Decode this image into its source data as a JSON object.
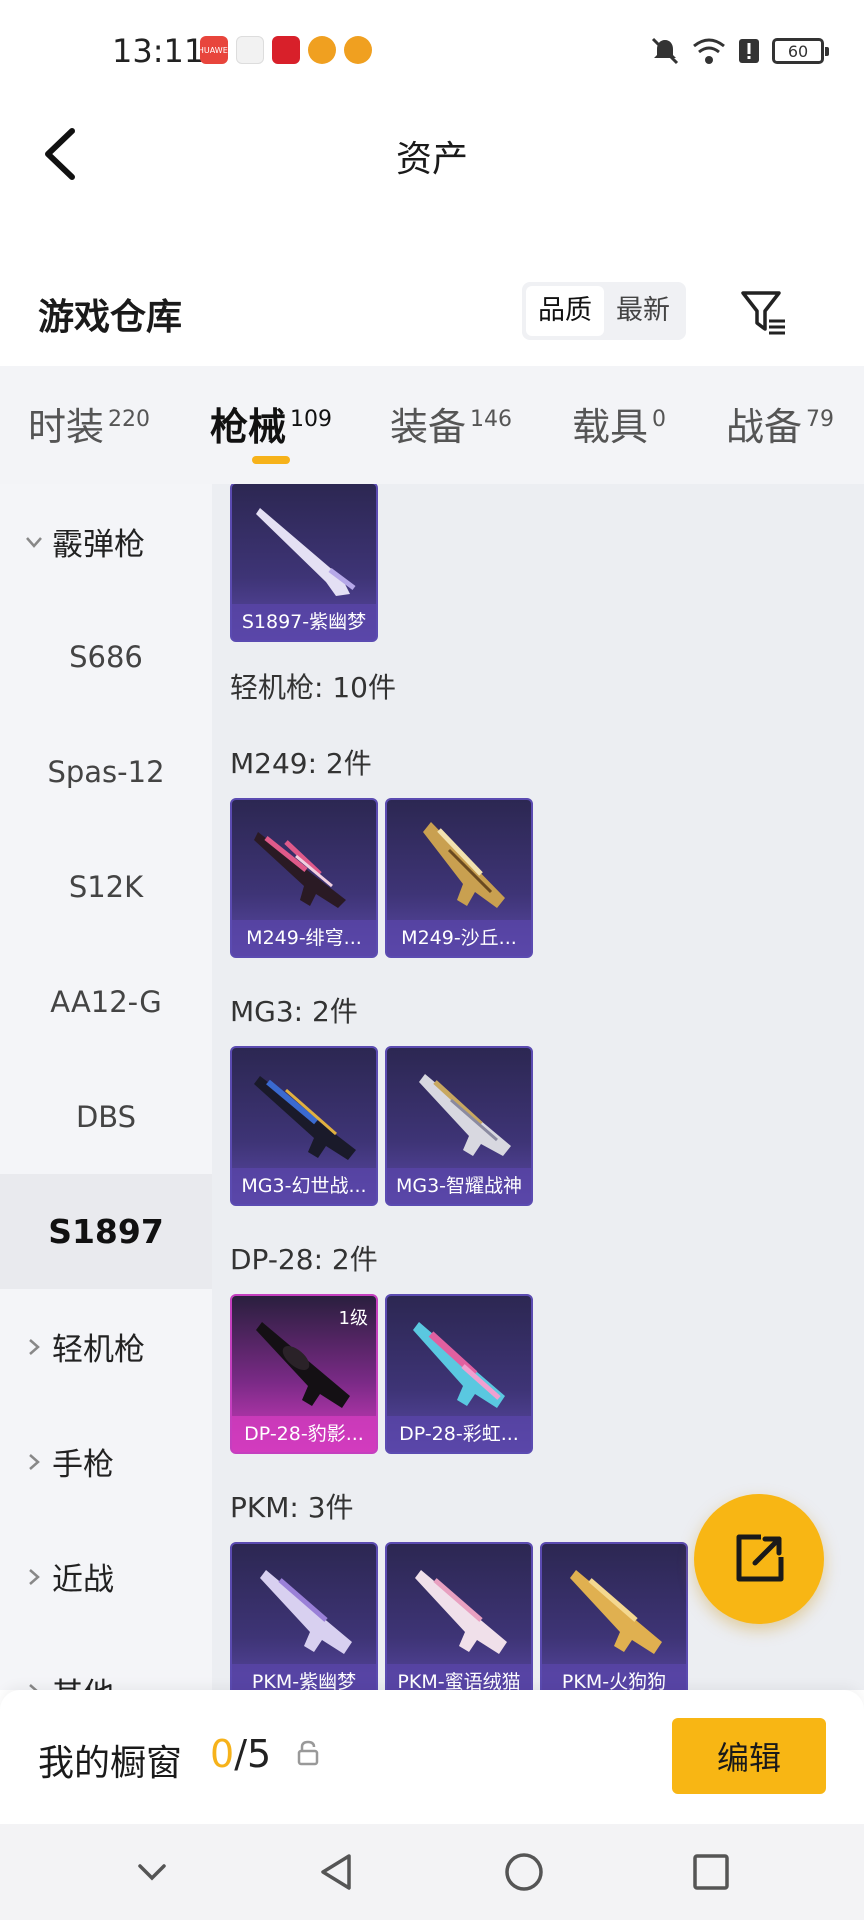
{
  "status_bar": {
    "time": "13:11",
    "battery": "60",
    "apps": [
      {
        "name": "huawei-app-icon",
        "color": "#e8453c",
        "label": "HUAWEI"
      },
      {
        "name": "gift-app-icon",
        "color": "#e05a6a",
        "label": ""
      },
      {
        "name": "heart-app-icon",
        "color": "#d8202a",
        "label": ""
      },
      {
        "name": "cat-app-icon",
        "color": "#f0a020",
        "label": ""
      },
      {
        "name": "cat-app-icon-2",
        "color": "#f0a020",
        "label": ""
      }
    ]
  },
  "header": {
    "title": "资产"
  },
  "section": {
    "title": "游戏仓库",
    "sort_quality": "品质",
    "sort_newest": "最新"
  },
  "tabs": [
    {
      "label": "时装",
      "count": "220"
    },
    {
      "label": "枪械",
      "count": "109"
    },
    {
      "label": "装备",
      "count": "146"
    },
    {
      "label": "载具",
      "count": "0"
    },
    {
      "label": "战备",
      "count": "79"
    }
  ],
  "sidebar": {
    "group_shotgun": "霰弹枪",
    "items": [
      "S686",
      "Spas-12",
      "S12K",
      "AA12-G",
      "DBS",
      "S1897"
    ],
    "group_lmg": "轻机枪",
    "group_pistol": "手枪",
    "group_melee": "近战",
    "group_other": "其他"
  },
  "content": {
    "top_card": "S1897-紫幽梦",
    "lmg_header": "轻机枪: 10件",
    "m249_header": "M249: 2件",
    "m249_cards": [
      "M249-绯穹...",
      "M249-沙丘..."
    ],
    "mg3_header": "MG3: 2件",
    "mg3_cards": [
      "MG3-幻世战...",
      "MG3-智耀战神"
    ],
    "dp28_header": "DP-28: 2件",
    "dp28_cards": [
      "DP-28-豹影...",
      "DP-28-彩虹..."
    ],
    "dp28_badge": "1级",
    "pkm_header": "PKM: 3件",
    "pkm_cards": [
      "PKM-紫幽梦",
      "PKM-蜜语绒猫",
      "PKM-火狗狗"
    ]
  },
  "bottom": {
    "showcase_label": "我的橱窗",
    "showcase_current": "0",
    "showcase_total": "/5",
    "edit_label": "编辑"
  },
  "colors": {
    "accent": "#f8b614",
    "card_purple": "#5b4bb1",
    "card_pink": "#d43cc0"
  }
}
